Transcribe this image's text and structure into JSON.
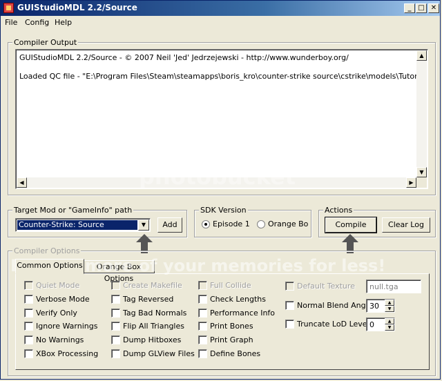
{
  "window": {
    "title": "GUIStudioMDL 2.2/Source",
    "controls": [
      "minimize-button",
      "maximize-button",
      "close-button"
    ]
  },
  "menu": [
    "File",
    "Config",
    "Help"
  ],
  "compiler_output": {
    "label": "Compiler Output",
    "lines": [
      "GUIStudioMDL 2.2/Source - © 2007 Neil 'Jed' Jedrzejewski - http://www.wunderboy.org/",
      "Loaded QC file - \"E:\\Program Files\\Steam\\steamapps\\boris_kro\\counter-strike source\\cstrike\\models\\Tutorial model.qc\""
    ]
  },
  "target_mod": {
    "label": "Target Mod or \"GameInfo\" path",
    "selected": "Counter-Strike: Source",
    "add_label": "Add"
  },
  "sdk_version": {
    "label": "SDK Version",
    "options": [
      {
        "label": "Episode 1",
        "checked": true
      },
      {
        "label": "Orange Box",
        "checked": false
      }
    ]
  },
  "actions": {
    "label": "Actions",
    "compile_label": "Compile",
    "clear_log_label": "Clear Log"
  },
  "compiler_options": {
    "label": "Compiler Options",
    "tabs": [
      "Common Options",
      "Orange Box Options"
    ],
    "columns": [
      [
        {
          "label": "Quiet Mode",
          "disabled": true
        },
        {
          "label": "Verbose Mode",
          "disabled": false
        },
        {
          "label": "Verify Only",
          "disabled": false
        },
        {
          "label": "Ignore Warnings",
          "disabled": false
        },
        {
          "label": "No Warnings",
          "disabled": false
        },
        {
          "label": "XBox Processing",
          "disabled": false
        }
      ],
      [
        {
          "label": "Create Makefile",
          "disabled": true
        },
        {
          "label": "Tag Reversed",
          "disabled": false
        },
        {
          "label": "Tag Bad Normals",
          "disabled": false
        },
        {
          "label": "Flip All Triangles",
          "disabled": false
        },
        {
          "label": "Dump Hitboxes",
          "disabled": false
        },
        {
          "label": "Dump GLView Files",
          "disabled": false
        }
      ],
      [
        {
          "label": "Full Collide",
          "disabled": true
        },
        {
          "label": "Check Lengths",
          "disabled": false
        },
        {
          "label": "Performance Info",
          "disabled": false
        },
        {
          "label": "Print Bones",
          "disabled": false
        },
        {
          "label": "Print Graph",
          "disabled": false
        },
        {
          "label": "Define Bones",
          "disabled": false
        }
      ]
    ],
    "default_texture": {
      "label": "Default Texture",
      "value": "null.tga"
    },
    "normal_blend_angle": {
      "label": "Normal Blend Angle",
      "value": "30"
    },
    "truncate_lod_level": {
      "label": "Truncate LoD Level",
      "value": "0"
    }
  },
  "watermark": {
    "brand": "photobucket",
    "tagline": "Protect more of your memories for less!"
  },
  "colors": {
    "title_gradient_start": "#0a246a",
    "title_gradient_end": "#a6caf0",
    "face": "#ece9d8",
    "selection": "#0a246a"
  }
}
